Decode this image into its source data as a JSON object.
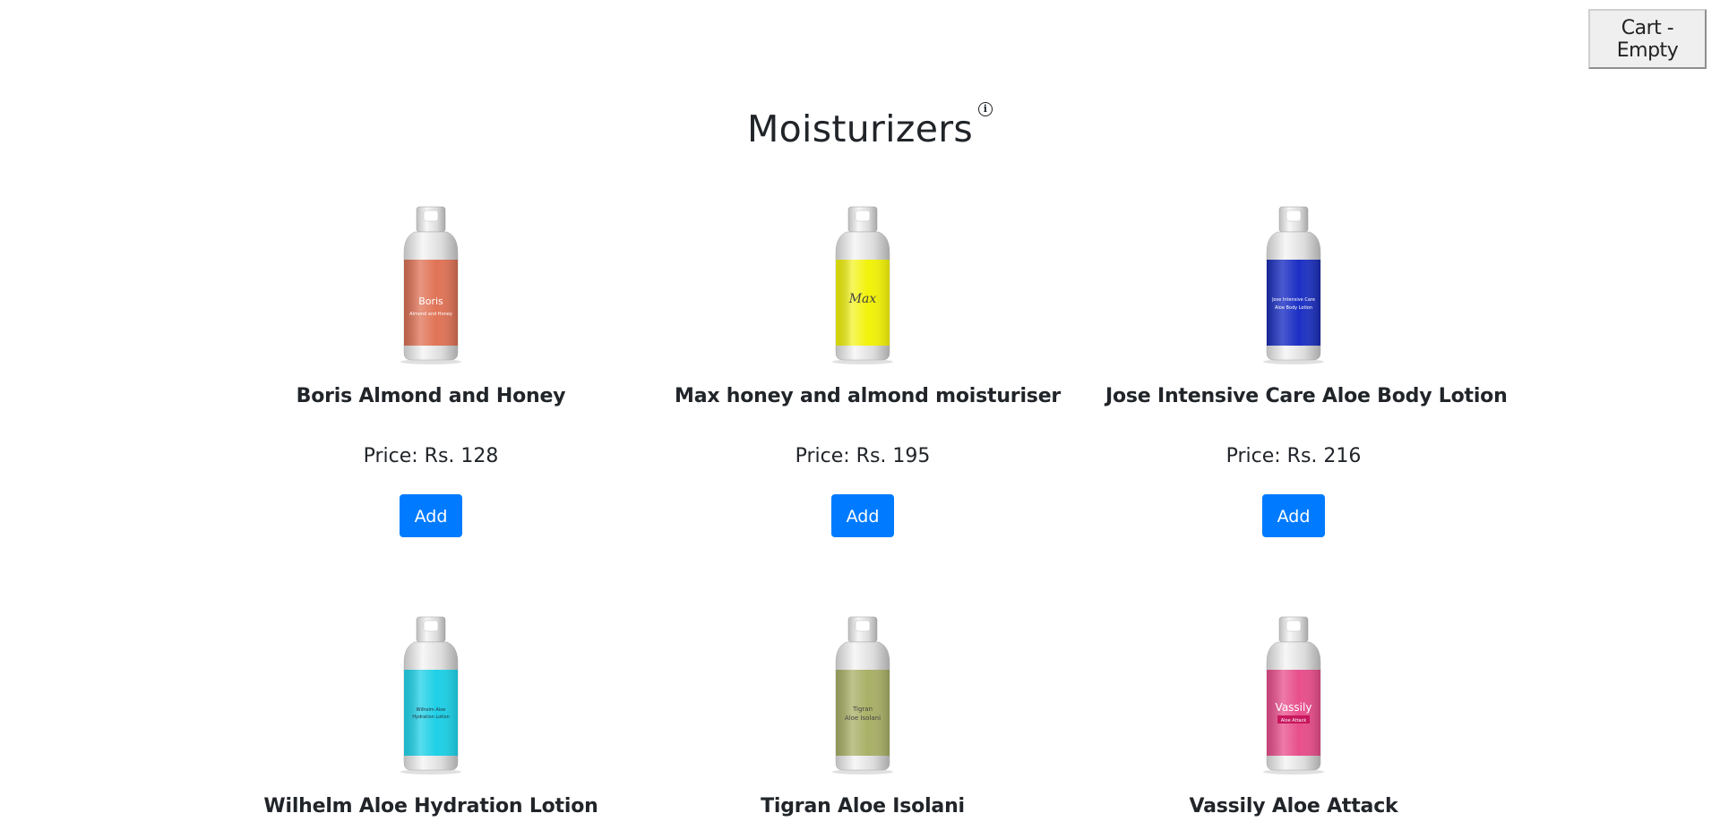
{
  "cart": {
    "label": "Cart - Empty"
  },
  "page": {
    "title": "Moisturizers",
    "info_icon_glyph": "i"
  },
  "products": [
    {
      "name": "Boris Almond and Honey",
      "price": "Price: Rs. 128",
      "add_label": "Add",
      "label_color": "#e07356",
      "label_text_1": "Boris",
      "label_text_2": "Almond and Honey"
    },
    {
      "name": "Max honey and almond moisturiser",
      "price": "Price: Rs. 195",
      "add_label": "Add",
      "label_color": "#f2f20a",
      "label_text_1": "Max",
      "label_text_2": ""
    },
    {
      "name": "Jose Intensive Care Aloe Body Lotion",
      "price": "Price: Rs. 216",
      "add_label": "Add",
      "label_color": "#1b2fc4",
      "label_text_1": "Jose Intensive Care",
      "label_text_2": "Aloe Body Lotion"
    },
    {
      "name": "Wilhelm Aloe Hydration Lotion",
      "label_color": "#1fd0e6",
      "label_text_1": "Wilhelm Aloe",
      "label_text_2": "Hydration Lotion"
    },
    {
      "name": "Tigran Aloe Isolani",
      "label_color": "#a9b067",
      "label_text_1": "Tigran",
      "label_text_2": "Aloe Isolani"
    },
    {
      "name": "Vassily Aloe Attack",
      "label_color": "#e84f8c",
      "label_text_1": "Vassily",
      "label_text_2": "Aloe Attack"
    }
  ]
}
